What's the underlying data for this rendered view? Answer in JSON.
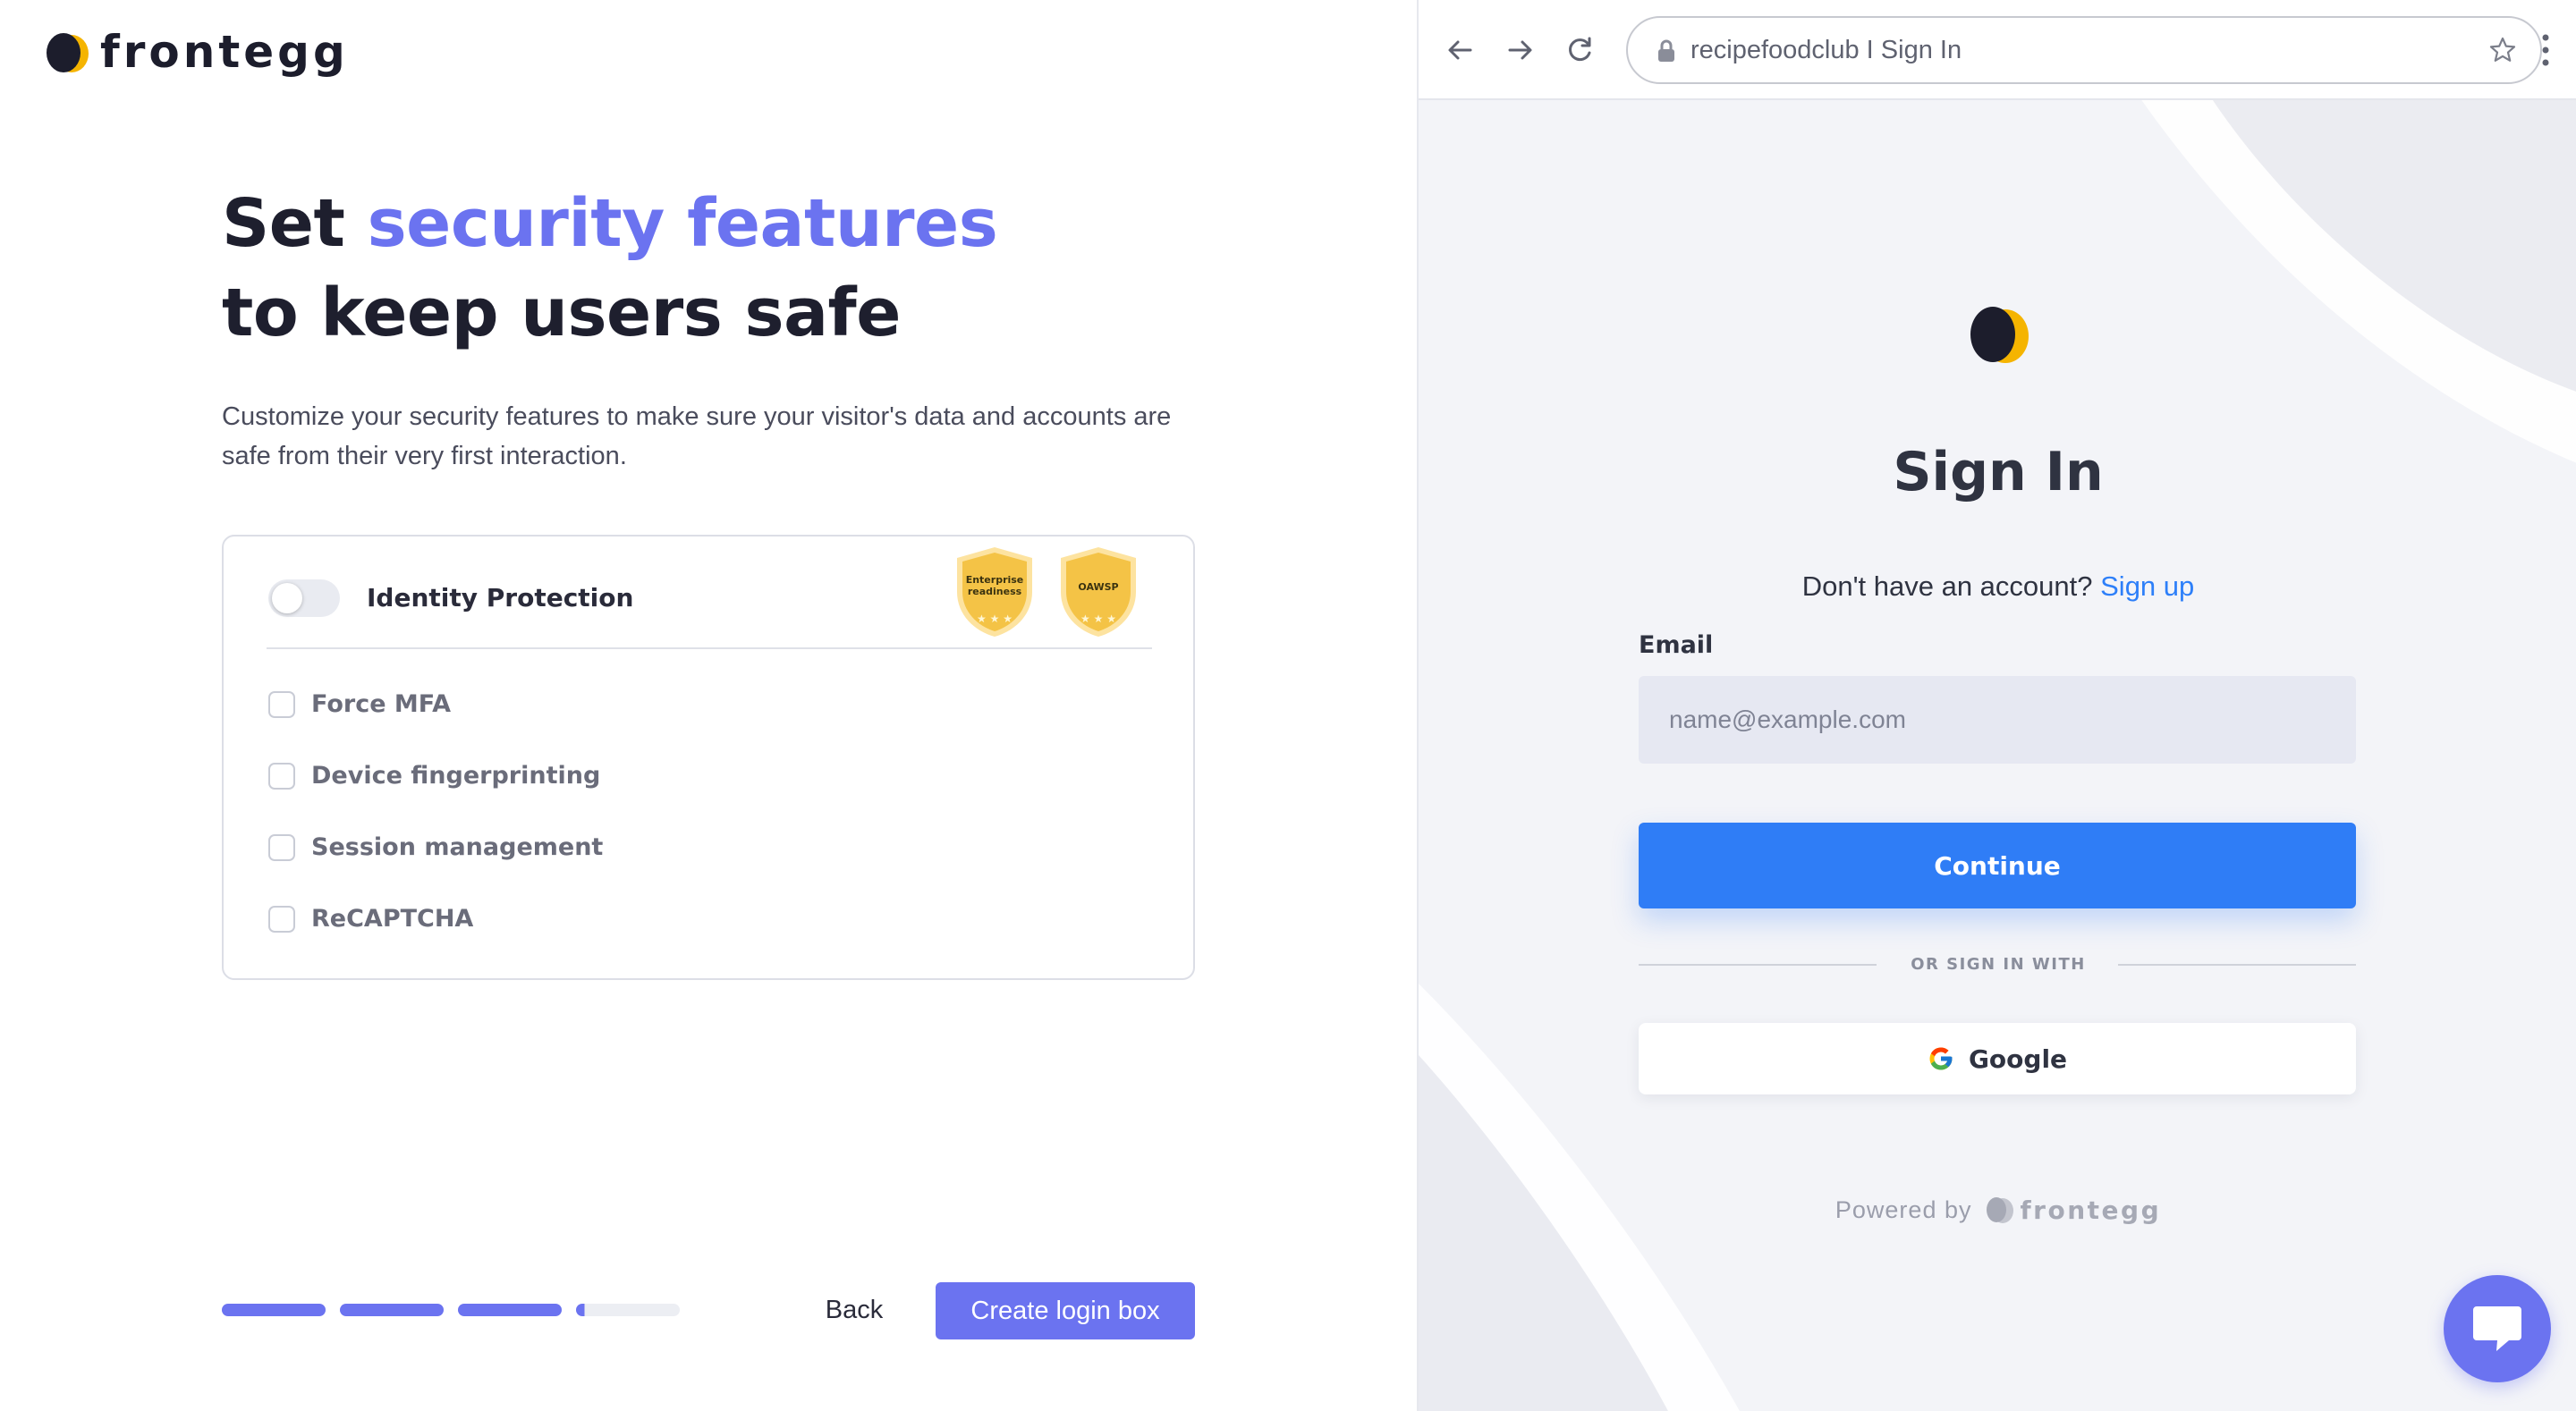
{
  "left": {
    "brand": "frontegg",
    "headline": {
      "line1_prefix": "Set",
      "line1_accent": "security features",
      "line2": "to keep users safe"
    },
    "description": "Customize your security features to make sure your visitor's data and accounts are safe from their very first interaction.",
    "card": {
      "title": "Identity Protection",
      "toggle_on": false,
      "badges": [
        {
          "line1": "Enterprise",
          "line2": "readiness"
        },
        {
          "line1": "OAWSP",
          "line2": ""
        }
      ],
      "options": [
        {
          "label": "Force MFA",
          "checked": false
        },
        {
          "label": "Device fingerprinting",
          "checked": false
        },
        {
          "label": "Session management",
          "checked": false
        },
        {
          "label": "ReCAPTCHA",
          "checked": false
        }
      ]
    },
    "progress": {
      "completed_steps": 3,
      "total_steps": 4,
      "current_step_fraction": 0.08
    },
    "back_label": "Back",
    "create_label": "Create login box",
    "accent_color": "#6b73f0"
  },
  "right": {
    "browser": {
      "url": "recipefoodclub I Sign In"
    },
    "signin": {
      "title": "Sign In",
      "no_account_text": "Don't have an account?",
      "signup_link": "Sign up",
      "email_label": "Email",
      "email_placeholder": "name@example.com",
      "continue_label": "Continue",
      "or_text": "OR SIGN IN WITH",
      "google_label": "Google",
      "powered_by": "Powered by",
      "powered_brand": "frontegg",
      "primary_color": "#2f7df6"
    }
  }
}
